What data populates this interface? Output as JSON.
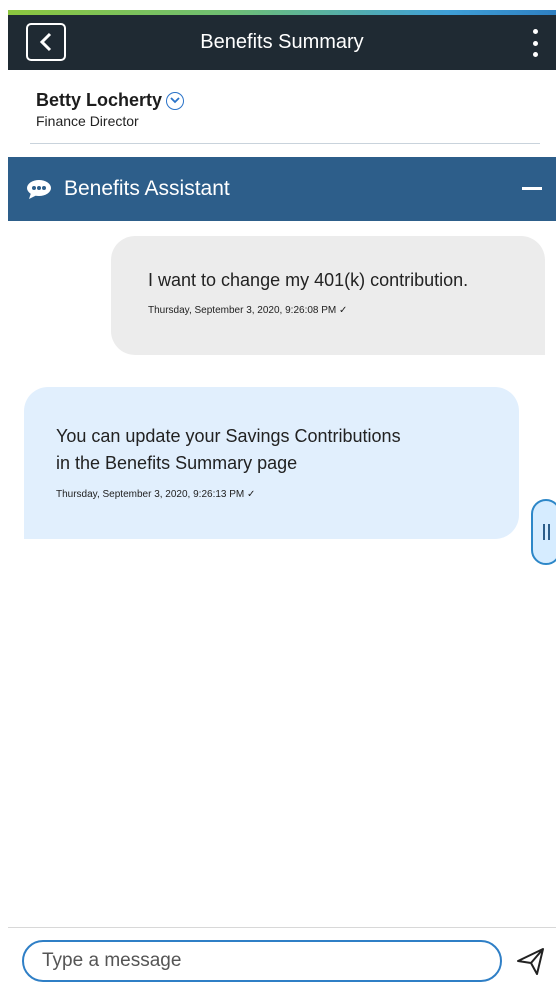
{
  "header": {
    "title": "Benefits Summary",
    "back_icon": "chevron-left-icon",
    "more_icon": "vertical-ellipsis-icon"
  },
  "user": {
    "name": "Betty Locherty",
    "role": "Finance Director",
    "menu_icon": "chevron-down-circle-icon"
  },
  "assistant": {
    "title": "Benefits Assistant",
    "icon": "chat-bubble-icon",
    "minimize_icon": "minimize-icon"
  },
  "messages": [
    {
      "sender": "user",
      "text": "I want to change my 401(k) contribution.",
      "timestamp": "Thursday, September 3, 2020, 9:26:08 PM ✓"
    },
    {
      "sender": "bot",
      "text_line1": "You can update your Savings Contributions",
      "text_line2": "in the Benefits Summary page",
      "timestamp": "Thursday, September 3, 2020, 9:26:13 PM ✓"
    }
  ],
  "composer": {
    "placeholder": "Type a message",
    "send_icon": "send-icon"
  },
  "colors": {
    "header_bg": "#1f2a33",
    "assistant_bar": "#2d5e8a",
    "user_bubble": "#ececec",
    "bot_bubble": "#e1effd",
    "input_border": "#2f7fc6"
  }
}
